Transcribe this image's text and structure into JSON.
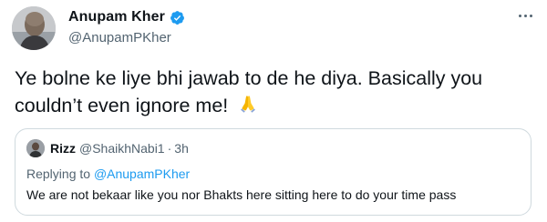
{
  "tweet": {
    "author_name": "Anupam Kher",
    "author_handle": "@AnupamPKher",
    "verified": true,
    "text": "Ye bolne ke liye bhi jawab to de he diya. Basically you couldn’t even ignore me!",
    "emoji": "folded-hands"
  },
  "quoted_tweet": {
    "author_name": "Rizz",
    "author_handle": "@ShaikhNabi1",
    "separator": "·",
    "time": "3h",
    "replying_to_prefix": "Replying to",
    "replying_to_handle": "@AnupamPKher",
    "text": "We are not bekaar like you nor Bhakts here sitting here to do your time pass"
  },
  "colors": {
    "verified_badge": "#1d9bf0",
    "secondary_text": "#536471",
    "link": "#1d9bf0",
    "border": "#cfd9de"
  }
}
